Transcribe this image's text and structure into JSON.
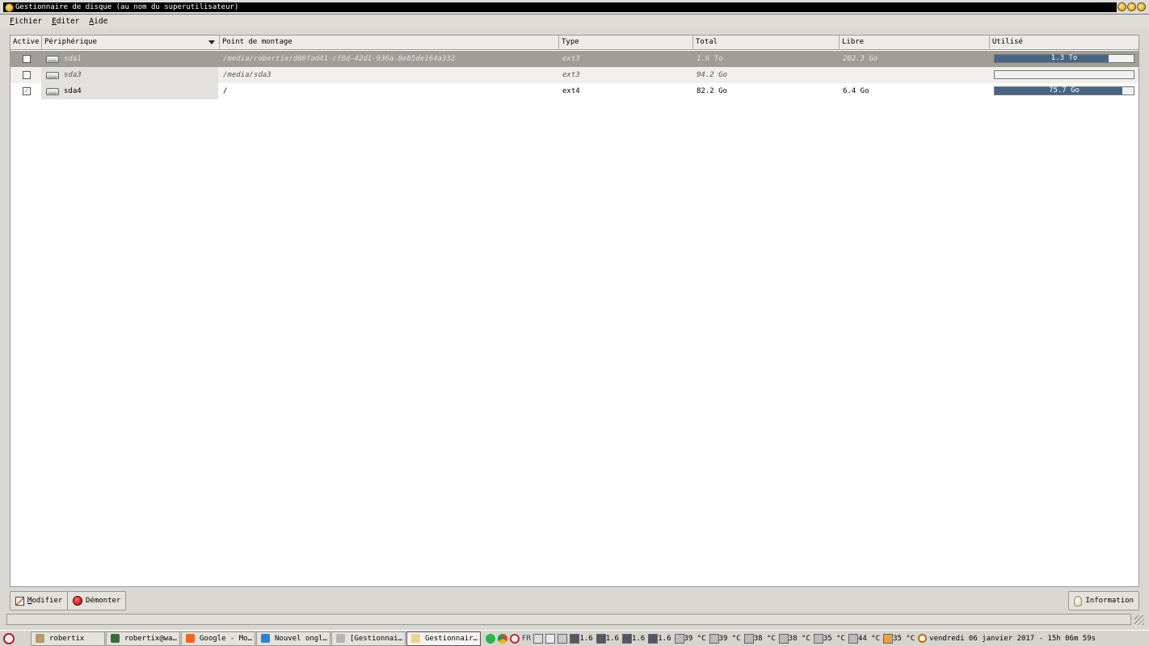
{
  "window": {
    "title": "Gestionnaire de disque (au nom du superutilisateur)"
  },
  "menubar": {
    "items": [
      {
        "label": "Fichier",
        "mnemonic": "F",
        "rest": "ichier"
      },
      {
        "label": "Editer",
        "mnemonic": "E",
        "rest": "diter"
      },
      {
        "label": "Aide",
        "mnemonic": "A",
        "rest": "ide"
      }
    ]
  },
  "table": {
    "columns": [
      "Active",
      "Périphérique",
      "Point de montage",
      "Type",
      "Total",
      "Libre",
      "Utilisé"
    ],
    "rows": [
      {
        "active": false,
        "device": "sda1",
        "mount": "/media/robertix/d08fad41-cf8d-42d1-936a-8e85de164a332",
        "type": "ext3",
        "total": "1.6 To",
        "free": "202.3 Go",
        "used_label": "1.3 To",
        "used_fraction": 0.82,
        "state": "selected"
      },
      {
        "active": false,
        "device": "sda3",
        "mount": "/media/sda3",
        "type": "ext3",
        "total": "94.2 Go",
        "free": "",
        "used_label": "",
        "used_fraction": 0,
        "state": "unmounted"
      },
      {
        "active": true,
        "device": "sda4",
        "mount": "/",
        "type": "ext4",
        "total": "82.2 Go",
        "free": "6.4 Go",
        "used_label": "75.7 Go",
        "used_fraction": 0.92,
        "state": "mounted"
      }
    ]
  },
  "buttons": {
    "modify": "Modifier",
    "modify_mnemonic": "M",
    "modify_rest": "odifier",
    "unmount": "Démonter",
    "information": "Information"
  },
  "taskbar": {
    "tasks": [
      {
        "label": "robertix",
        "icon_color": "#b89a6a"
      },
      {
        "label": "robertix@wa…",
        "icon_color": "#3b6b3b"
      },
      {
        "label": "Google - Mo…",
        "icon_color": "#e86a1f"
      },
      {
        "label": "Nouvel ongl…",
        "icon_color": "#2d7fd3"
      },
      {
        "label": "[Gestionnai…",
        "icon_color": "#b5b5b5"
      },
      {
        "label": "Gestionnair…",
        "icon_color": "#e8d48a"
      }
    ],
    "lang": "FR",
    "cpu": [
      "1.6",
      "1.6",
      "1.6",
      "1.6"
    ],
    "temps": [
      "39 °C",
      "39 °C",
      "38 °C",
      "38 °C",
      "35 °C",
      "44 °C",
      "35 °C"
    ],
    "clock": "vendredi 06 janvier 2017 - 15h 06m 59s"
  },
  "colors": {
    "used_bar": "#4a6584",
    "selected_row": "#a09d97"
  }
}
